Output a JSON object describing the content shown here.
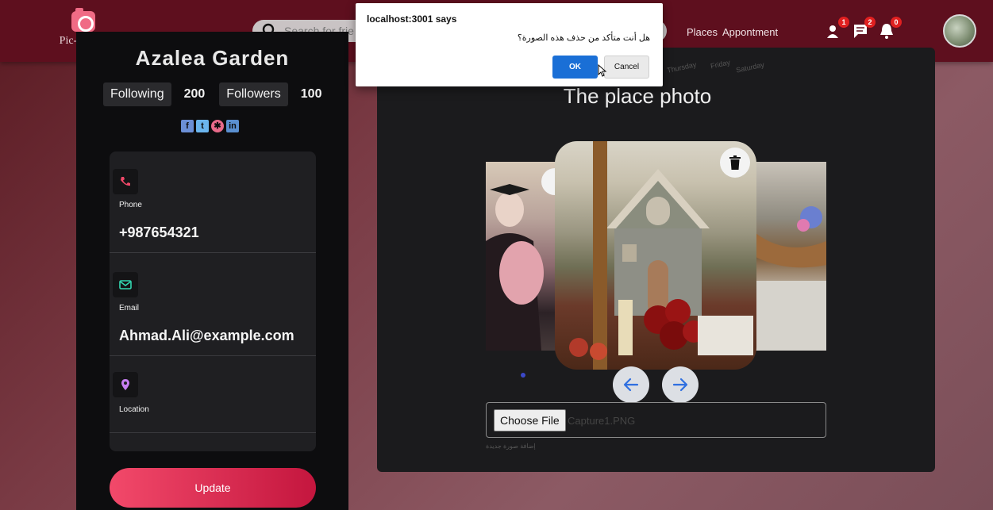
{
  "navbar": {
    "logo_text": "Pic-A-Boo",
    "search_placeholder": "Search for frie",
    "links": [
      "Places",
      "Appontment"
    ],
    "badges": {
      "friends": "1",
      "messages": "2",
      "notifications": "0"
    }
  },
  "profile": {
    "name": "Azalea Garden",
    "following_label": "Following",
    "following_count": "200",
    "followers_label": "Followers",
    "followers_count": "100",
    "phone_label": "Phone",
    "phone_value": "+987654321",
    "email_label": "Email",
    "email_value": "Ahmad.Ali@example.com",
    "location_label": "Location",
    "update_label": "Update"
  },
  "place": {
    "days": [
      "Thursday",
      "Friday",
      "Saturday"
    ],
    "title": "The place photo",
    "choose_file_label": "Choose File",
    "file_name": "Capture1.PNG",
    "helper_text": "إضافة صورة جديدة"
  },
  "dialog": {
    "title": "localhost:3001 says",
    "message": "هل أنت متأكد من حذف هذه الصورة؟",
    "ok_label": "OK",
    "cancel_label": "Cancel"
  },
  "colors": {
    "navbar": "#5e0f1e",
    "accent": "#f2496a",
    "dialog_ok": "#1a6fd6"
  }
}
